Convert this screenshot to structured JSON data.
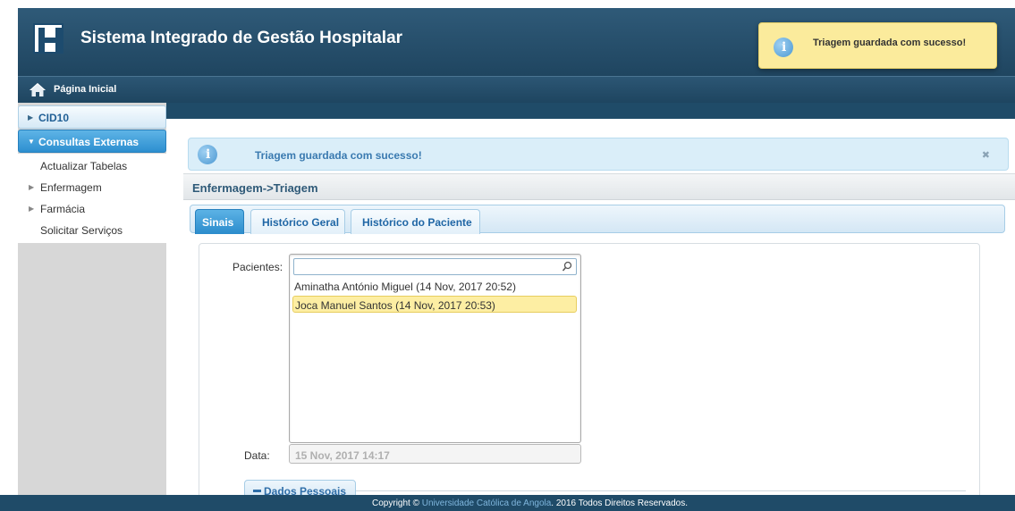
{
  "header": {
    "title": "Sistema Integrado de Gestão Hospitalar",
    "logo_letter": "H"
  },
  "nav": {
    "home_label": "Página Inicial"
  },
  "sidebar": {
    "sections": [
      {
        "label": "CID10",
        "expanded": false
      },
      {
        "label": "Consultas Externas",
        "expanded": true
      }
    ],
    "items": [
      {
        "label": "Actualizar Tabelas",
        "has_arrow": false
      },
      {
        "label": "Enfermagem",
        "has_arrow": true
      },
      {
        "label": "Farmácia",
        "has_arrow": true
      },
      {
        "label": "Solicitar Serviços",
        "has_arrow": false
      }
    ]
  },
  "message": {
    "text": "Triagem guardada com sucesso!",
    "close": "✖"
  },
  "breadcrumb": "Enfermagem->Triagem",
  "tabs": [
    {
      "label": "Sinais",
      "active": true
    },
    {
      "label": "Histórico Geral",
      "active": false
    },
    {
      "label": "Histórico do Paciente",
      "active": false
    }
  ],
  "form": {
    "pacientes_label": "Pacientes:",
    "filter_value": "",
    "patients": [
      {
        "label": "Aminatha António Miguel (14 Nov, 2017 20:52)",
        "selected": false
      },
      {
        "label": "Joca Manuel Santos (14 Nov, 2017 20:53)",
        "selected": true
      }
    ],
    "data_label": "Data:",
    "data_value": "15 Nov, 2017 14:17",
    "fieldset_legend": "Dados Pessoais"
  },
  "footer": {
    "prefix": "Copyright © ",
    "link": "Universidade Católica de Angola",
    "suffix": ". 2016 Todos Direitos Reservados."
  },
  "growl": {
    "text": "Triagem guardada com sucesso!"
  },
  "colors": {
    "header": "#1f4560",
    "accent": "#2d8fd0",
    "growl_bg": "#fbeb9c"
  }
}
